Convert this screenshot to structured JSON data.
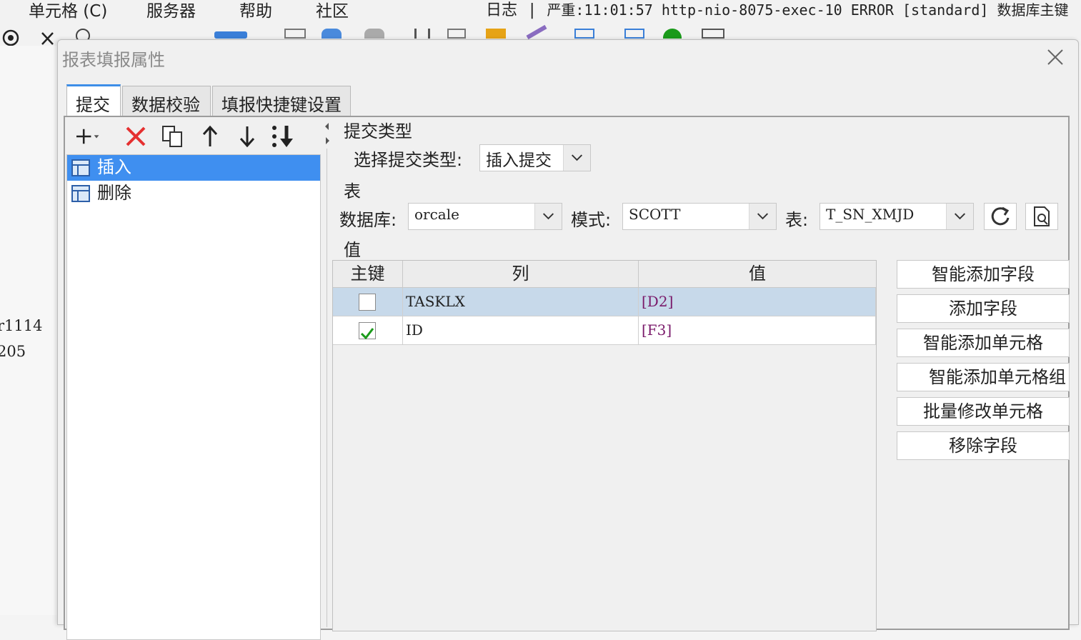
{
  "menubar": {
    "items": [
      "单元格 (C)",
      "服务器",
      "帮助",
      "社区"
    ],
    "log_label": "日志",
    "log_text": "严重:11:01:57 http-nio-8075-exec-10 ERROR [standard] 数据库主键"
  },
  "left_strip": {
    "line1": "r1114",
    "line2": "205"
  },
  "dialog": {
    "title": "报表填报属性",
    "tabs": [
      "提交",
      "数据校验",
      "填报快捷键设置"
    ]
  },
  "list": {
    "items": [
      "插入",
      "删除"
    ]
  },
  "submit_type": {
    "section_label": "提交类型",
    "select_label": "选择提交类型:",
    "selected": "插入提交"
  },
  "table_section": {
    "section_label": "表",
    "db_label": "数据库:",
    "db_value": "orcale",
    "schema_label": "模式:",
    "schema_value": "SCOTT",
    "table_label": "表:",
    "table_value": "T_SN_XMJD"
  },
  "values_section": {
    "section_label": "值",
    "headers": [
      "主键",
      "列",
      "值"
    ],
    "rows": [
      {
        "key": false,
        "column": "TASKLX",
        "value": "[D2]"
      },
      {
        "key": true,
        "column": "ID",
        "value": "[F3]"
      }
    ]
  },
  "actions": [
    "智能添加字段",
    "添加字段",
    "智能添加单元格",
    "智能添加单元格组",
    "批量修改单元格",
    "移除字段"
  ],
  "colors": {
    "accent": "#3f8ff0",
    "delete_red": "#e53030",
    "check_green": "#1a9a1a",
    "value_purple": "#7a1a6a"
  }
}
